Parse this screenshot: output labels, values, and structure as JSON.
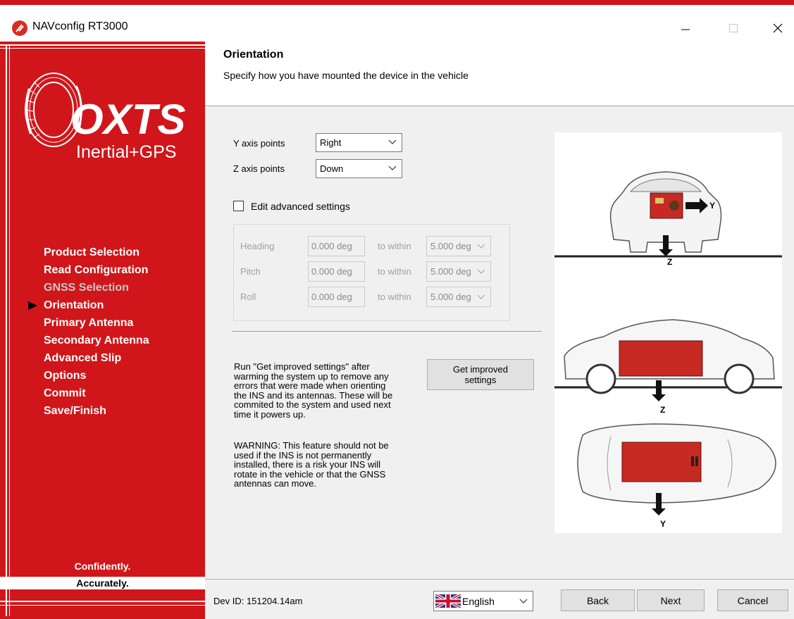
{
  "window": {
    "title": "NAVconfig RT3000",
    "controls": {
      "minimize": "minimize-icon",
      "maximize": "maximize-icon",
      "close": "close-icon"
    }
  },
  "sidebar": {
    "logo": {
      "brand": "OXTS",
      "tagline": "Inertial+GPS"
    },
    "items": [
      {
        "label": "Product Selection",
        "state": "normal"
      },
      {
        "label": "Read Configuration",
        "state": "normal"
      },
      {
        "label": "GNSS Selection",
        "state": "disabled"
      },
      {
        "label": "Orientation",
        "state": "current"
      },
      {
        "label": "Primary Antenna",
        "state": "normal"
      },
      {
        "label": "Secondary Antenna",
        "state": "normal"
      },
      {
        "label": "Advanced Slip",
        "state": "normal"
      },
      {
        "label": "Options",
        "state": "normal"
      },
      {
        "label": "Commit",
        "state": "normal"
      },
      {
        "label": "Save/Finish",
        "state": "normal"
      }
    ],
    "slogan_1": "Confidently.",
    "slogan_2": "Accurately.",
    "background_color": "#d0161a"
  },
  "header": {
    "title": "Orientation",
    "subtitle": "Specify how you have mounted the device in the vehicle"
  },
  "orientation": {
    "y_axis_label": "Y axis points",
    "y_axis_value": "Right",
    "z_axis_label": "Z axis points",
    "z_axis_value": "Down"
  },
  "advanced": {
    "checkbox_label": "Edit advanced settings",
    "checked": false,
    "within_label": "to within",
    "rows": [
      {
        "label": "Heading",
        "value": "0.000 deg",
        "tolerance": "5.000 deɡ"
      },
      {
        "label": "Pitch",
        "value": "0.000 deg",
        "tolerance": "5.000 deɡ"
      },
      {
        "label": "Roll",
        "value": "0.000 deg",
        "tolerance": "5.000 deɡ"
      }
    ]
  },
  "improved": {
    "description_lines": [
      "Run \"Get improved settings\" after",
      "warming the system up to remove any",
      "errors that were made when orienting",
      "the INS and its antennas. These will be",
      "commited to the system and used next",
      "time it powers up."
    ],
    "warning_lines": [
      "WARNING: This feature should not be",
      "used if the INS is not permanently",
      "installed, there is a risk your INS will",
      "rotate in the vehicle or that the GNSS",
      "antennas can move."
    ],
    "button_line1": "Get improved",
    "button_line2": "settings"
  },
  "illustration": {
    "views": [
      "rear",
      "side",
      "top"
    ],
    "axis_labels": {
      "rear_right": "Y",
      "rear_down": "Z",
      "side_down": "Z",
      "top_down": "Y"
    }
  },
  "footer": {
    "dev_id": "Dev ID: 151204.14am",
    "language": "English",
    "back": "Back",
    "next": "Next",
    "cancel": "Cancel"
  }
}
